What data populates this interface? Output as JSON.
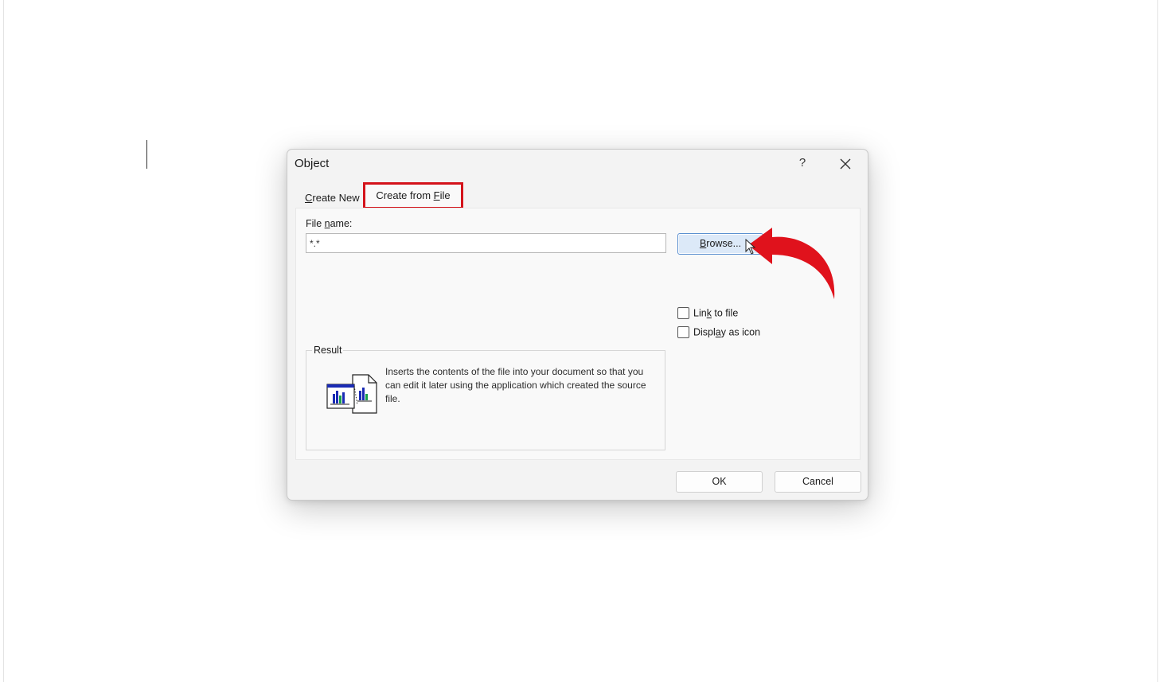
{
  "dialog": {
    "title": "Object",
    "help_label": "?",
    "tabs": [
      {
        "label_pre": "",
        "label_key": "C",
        "label_post": "reate New",
        "active": false
      },
      {
        "label_pre": "Create from ",
        "label_key": "F",
        "label_post": "ile",
        "active": true
      }
    ],
    "file_name": {
      "label_pre": "File ",
      "label_key": "n",
      "label_post": "ame:",
      "value": "*.*"
    },
    "browse_button": {
      "label_key": "B",
      "label_post": "rowse..."
    },
    "options": {
      "link_to_file": {
        "label_pre": "Lin",
        "label_key": "k",
        "label_post": " to file",
        "checked": false
      },
      "display_as_icon": {
        "label_pre": "Displ",
        "label_key": "a",
        "label_post": "y as icon",
        "checked": false
      }
    },
    "result": {
      "label": "Result",
      "text": "Inserts the contents of the file into your document so that you can edit it later using the application which created the source file."
    },
    "ok_label": "OK",
    "cancel_label": "Cancel"
  },
  "colors": {
    "highlight_box": "#d4131b",
    "annotation_arrow": "#e0121c",
    "browse_focus": "#5a8fd0"
  },
  "icons": {
    "close": "close-icon",
    "result": "embedded-chart-file-icon",
    "cursor": "mouse-pointer-icon",
    "annotation": "curved-red-arrow-icon"
  }
}
